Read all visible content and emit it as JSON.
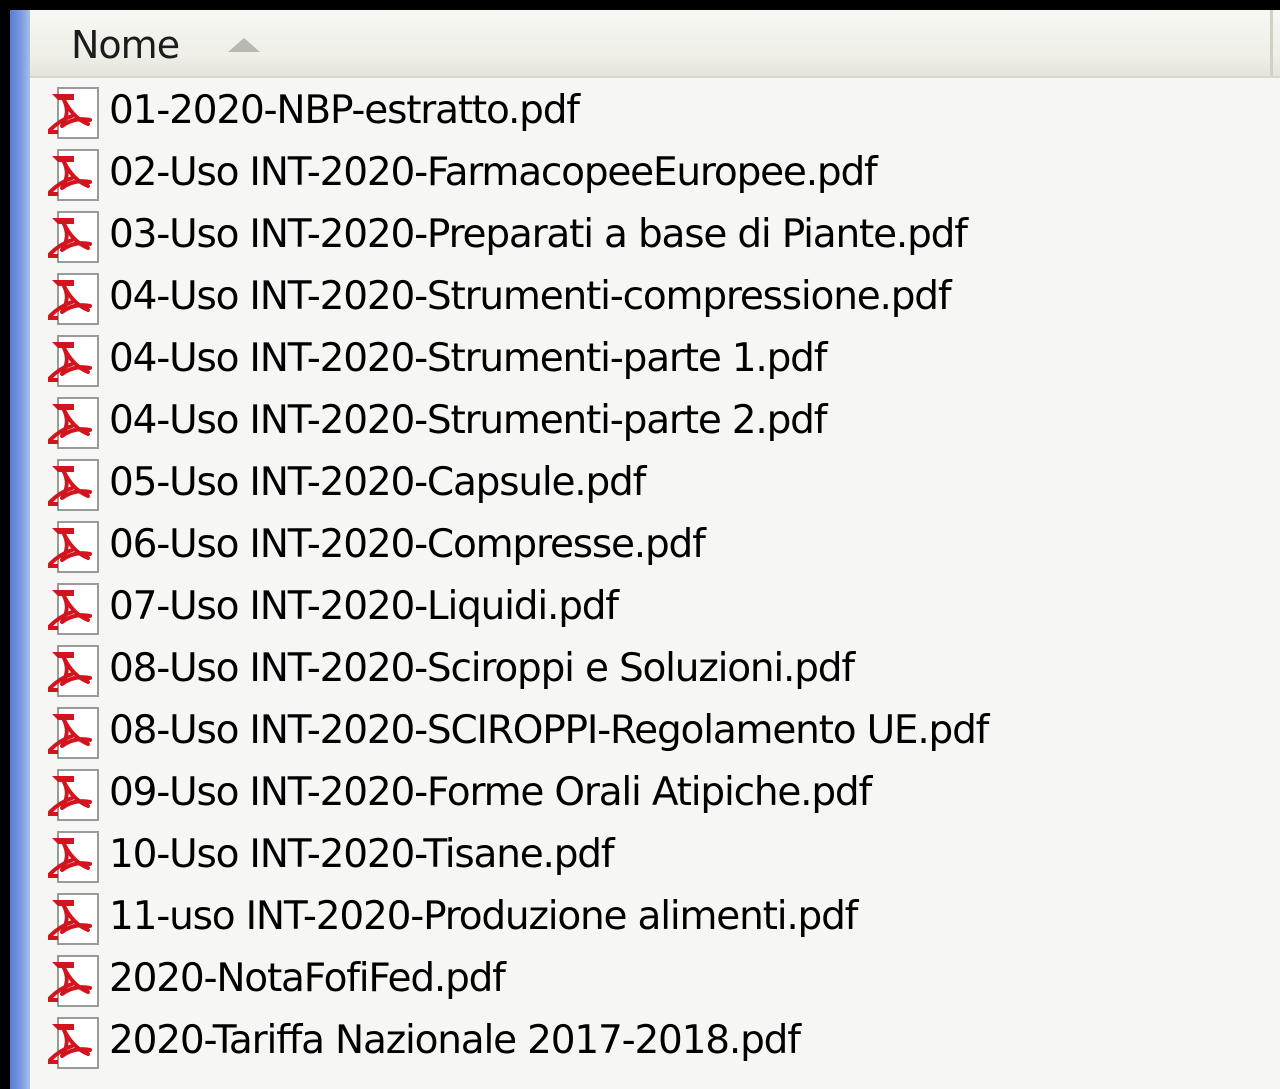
{
  "header": {
    "column_label": "Nome",
    "sort_icon": "sort-ascending-icon"
  },
  "files": [
    {
      "name": "01-2020-NBP-estratto.pdf",
      "icon": "pdf-file-icon"
    },
    {
      "name": "02-Uso INT-2020-FarmacopeeEuropee.pdf",
      "icon": "pdf-file-icon"
    },
    {
      "name": "03-Uso INT-2020-Preparati a base di Piante.pdf",
      "icon": "pdf-file-icon"
    },
    {
      "name": "04-Uso INT-2020-Strumenti-compressione.pdf",
      "icon": "pdf-file-icon"
    },
    {
      "name": "04-Uso INT-2020-Strumenti-parte 1.pdf",
      "icon": "pdf-file-icon"
    },
    {
      "name": "04-Uso INT-2020-Strumenti-parte 2.pdf",
      "icon": "pdf-file-icon"
    },
    {
      "name": "05-Uso INT-2020-Capsule.pdf",
      "icon": "pdf-file-icon"
    },
    {
      "name": "06-Uso INT-2020-Compresse.pdf",
      "icon": "pdf-file-icon"
    },
    {
      "name": "07-Uso INT-2020-Liquidi.pdf",
      "icon": "pdf-file-icon"
    },
    {
      "name": "08-Uso INT-2020-Sciroppi e Soluzioni.pdf",
      "icon": "pdf-file-icon"
    },
    {
      "name": "08-Uso INT-2020-SCIROPPI-Regolamento UE.pdf",
      "icon": "pdf-file-icon"
    },
    {
      "name": "09-Uso INT-2020-Forme Orali Atipiche.pdf",
      "icon": "pdf-file-icon"
    },
    {
      "name": "10-Uso INT-2020-Tisane.pdf",
      "icon": "pdf-file-icon"
    },
    {
      "name": "11-uso INT-2020-Produzione alimenti.pdf",
      "icon": "pdf-file-icon"
    },
    {
      "name": "2020-NotaFofiFed.pdf",
      "icon": "pdf-file-icon"
    },
    {
      "name": "2020-Tariffa Nazionale 2017-2018.pdf",
      "icon": "pdf-file-icon"
    }
  ],
  "colors": {
    "pdf_red": "#d2141e",
    "sidebar_blue": "#6f8fdc"
  }
}
